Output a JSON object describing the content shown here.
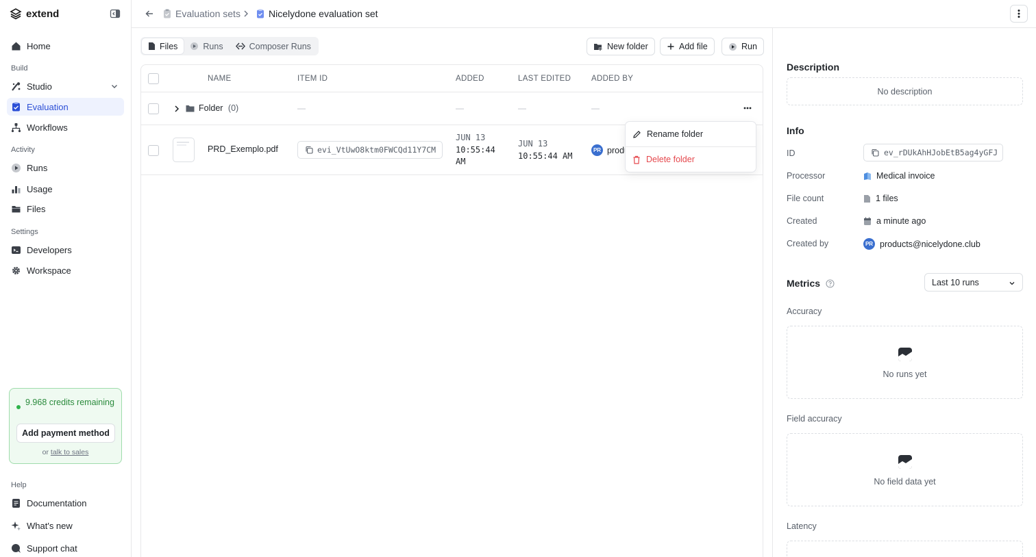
{
  "app": {
    "name": "extend"
  },
  "sidebar": {
    "home": "Home",
    "sections": {
      "build": "Build",
      "activity": "Activity",
      "settings": "Settings",
      "help": "Help"
    },
    "build_items": {
      "studio": "Studio",
      "evaluation": "Evaluation",
      "workflows": "Workflows"
    },
    "activity_items": {
      "runs": "Runs",
      "usage": "Usage",
      "files": "Files"
    },
    "settings_items": {
      "developers": "Developers",
      "workspace": "Workspace"
    },
    "help_items": {
      "documentation": "Documentation",
      "whats_new": "What's new",
      "support": "Support chat"
    },
    "credits": {
      "text": "9.968 credits remaining",
      "button": "Add payment method",
      "or": "or",
      "sales_link": "talk to sales"
    }
  },
  "header": {
    "crumb_parent": "Evaluation sets",
    "crumb_current": "Nicelydone evaluation set"
  },
  "toolbar": {
    "tabs": [
      "Files",
      "Runs",
      "Composer Runs"
    ],
    "new_folder": "New folder",
    "add_file": "Add file",
    "run": "Run"
  },
  "table": {
    "headers": {
      "name": "NAME",
      "item_id": "ITEM ID",
      "added": "ADDED",
      "last_edited": "LAST EDITED",
      "added_by": "ADDED BY"
    },
    "folder_row": {
      "name": "Folder",
      "count": "(0)",
      "empty": "—"
    },
    "file_row": {
      "name": "PRD_Exemplo.pdf",
      "item_id": "evi_VtUwO8ktm0FWCQd11Y7CM",
      "added_date": "JUN 13",
      "added_time_1": "10:55:44",
      "added_time_2": "AM",
      "edited_date": "JUN 13",
      "edited_time": "10:55:44 AM",
      "avatar": "PR",
      "added_by": "produ"
    }
  },
  "context_menu": {
    "rename": "Rename folder",
    "delete": "Delete folder"
  },
  "details": {
    "description_title": "Description",
    "description_empty": "No description",
    "info_title": "Info",
    "labels": {
      "id": "ID",
      "processor": "Processor",
      "file_count": "File count",
      "created": "Created",
      "created_by": "Created by"
    },
    "values": {
      "id": "ev_rDUkAhHJobEtB5ag4yGFJ",
      "processor": "Medical invoice",
      "file_count": "1 files",
      "created": "a minute ago",
      "created_by_avatar": "PR",
      "created_by": "products@nicelydone.club"
    },
    "metrics_title": "Metrics",
    "metrics_select": "Last 10 runs",
    "accuracy_title": "Accuracy",
    "accuracy_empty": "No runs yet",
    "field_accuracy_title": "Field accuracy",
    "field_accuracy_empty": "No field data yet",
    "latency_title": "Latency"
  },
  "colors": {
    "accent": "#2c4fd6",
    "danger": "#e5484d",
    "success": "#2a8a3c"
  }
}
